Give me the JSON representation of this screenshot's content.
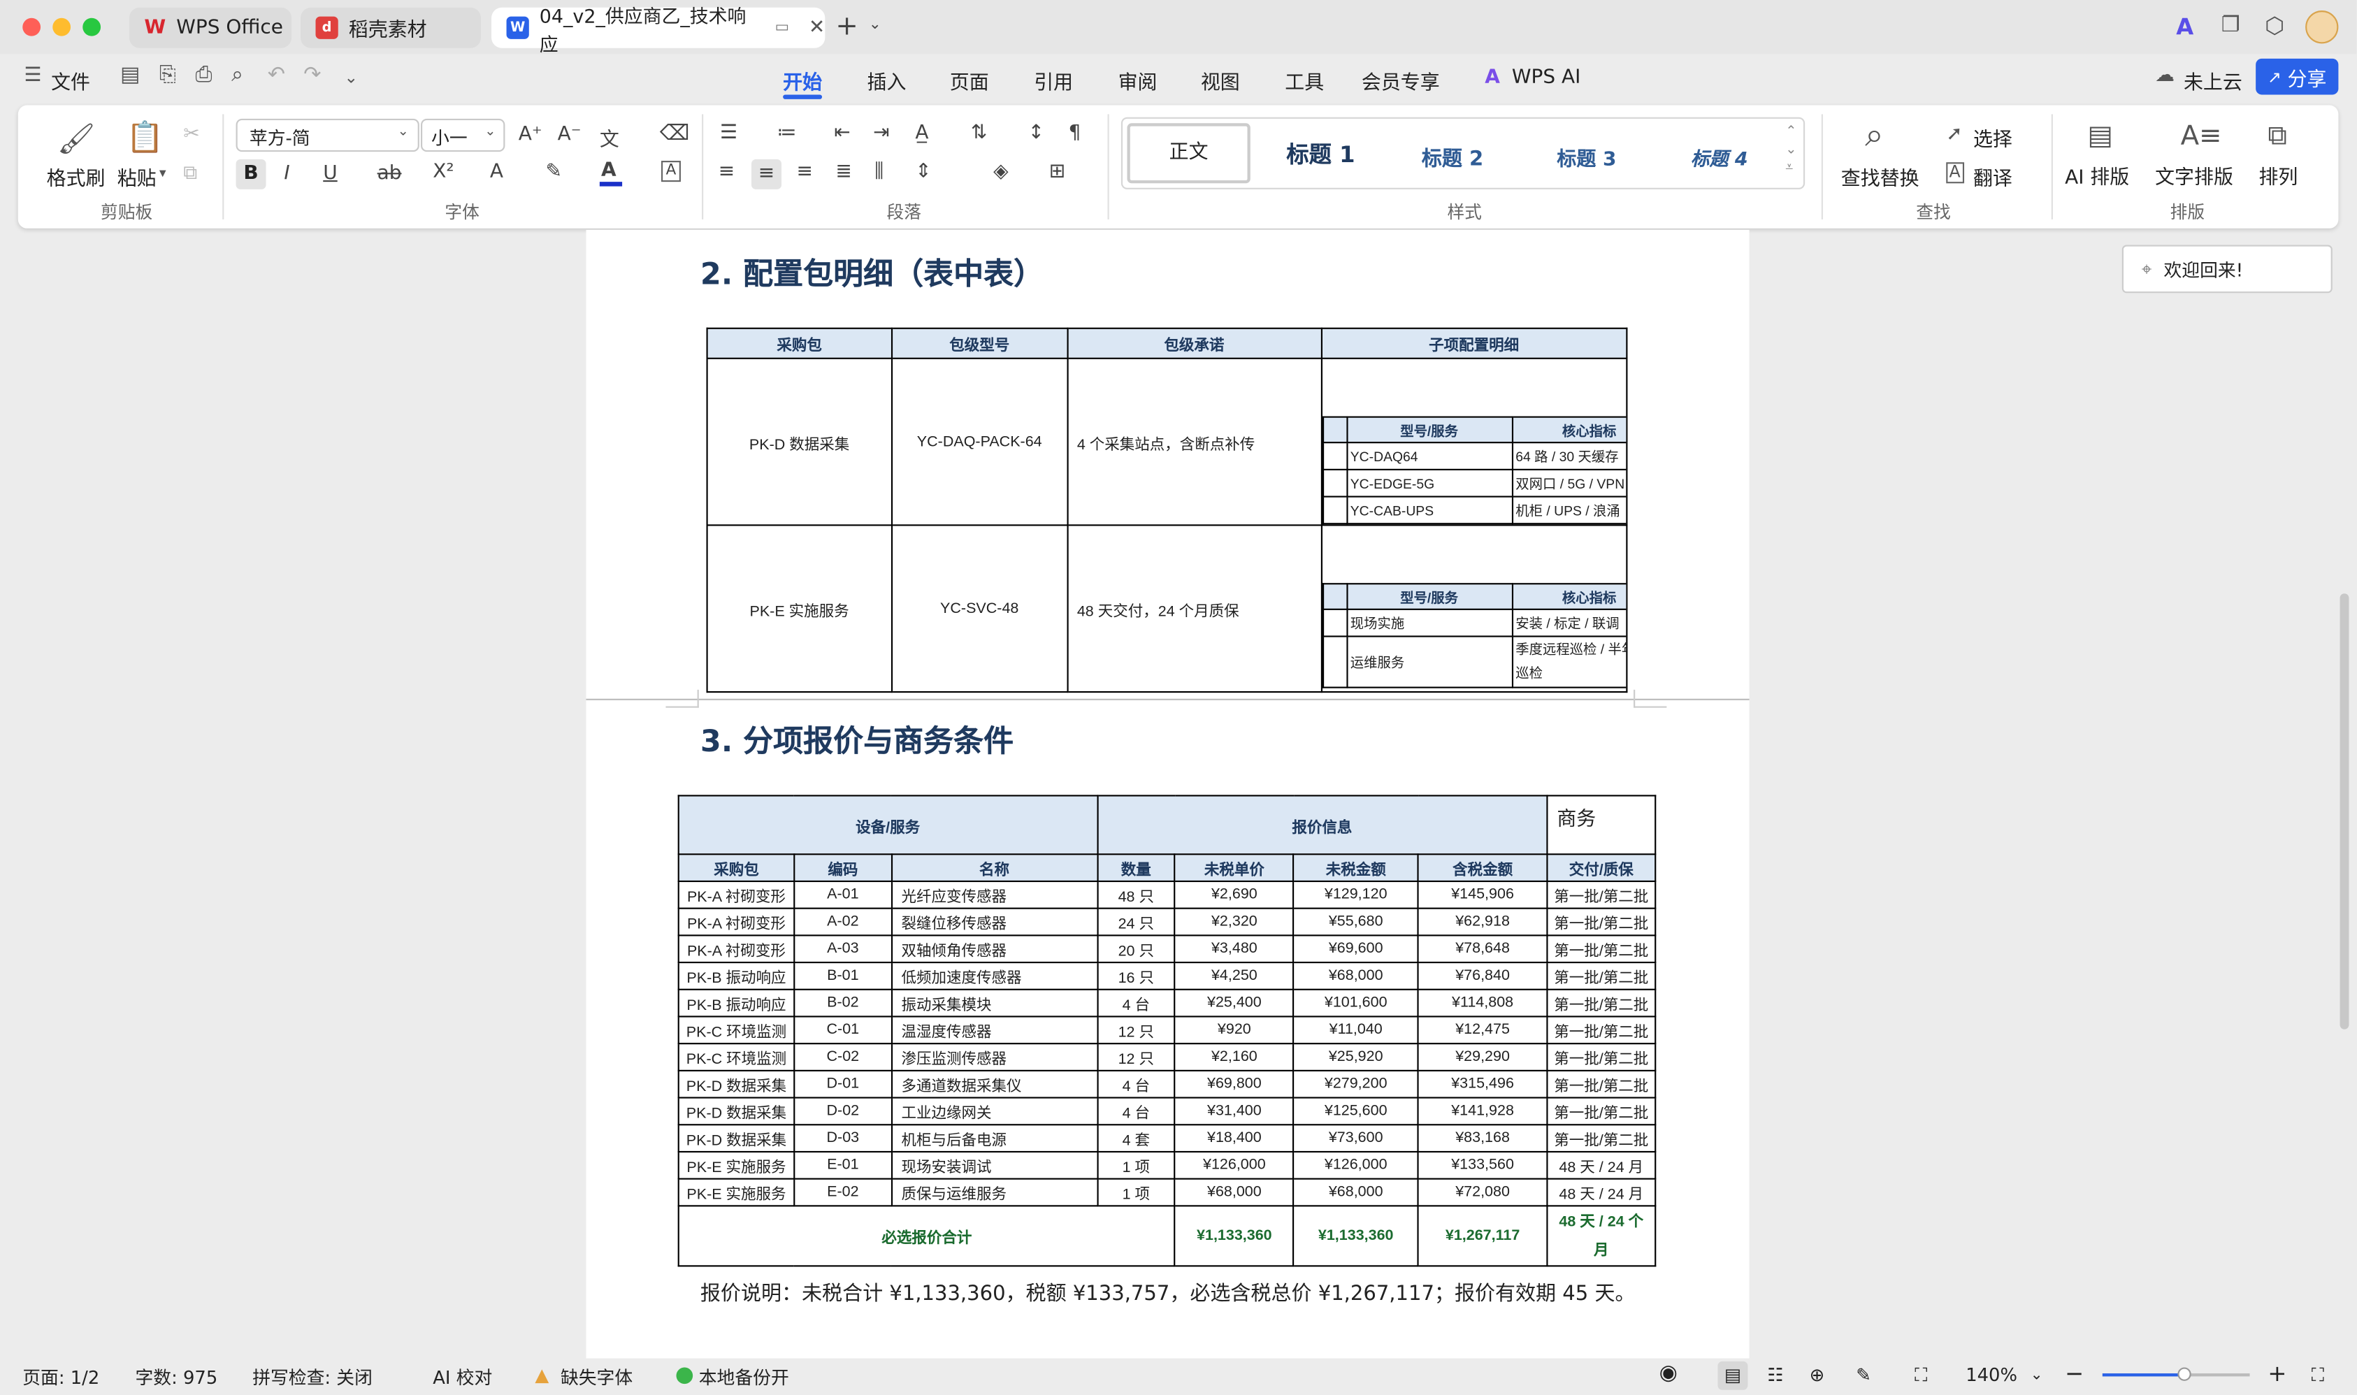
{
  "tabs": [
    {
      "label": "WPS Office"
    },
    {
      "label": "稻壳素材"
    },
    {
      "label": "04_v2_供应商乙_技术响应"
    }
  ],
  "menu": {
    "file": "文件",
    "items": [
      "开始",
      "插入",
      "页面",
      "引用",
      "审阅",
      "视图",
      "工具",
      "会员专享",
      "WPS AI"
    ],
    "cloud": "未上云",
    "share": "分享"
  },
  "ribbon": {
    "format_painter": "格式刷",
    "paste": "粘贴",
    "clipboard_group": "剪贴板",
    "font_name": "苹方-简",
    "font_size": "小一",
    "font_group": "字体",
    "para_group": "段落",
    "styles": [
      "正文",
      "标题 1",
      "标题 2",
      "标题 3",
      "标题 4"
    ],
    "styles_group": "样式",
    "find_replace": "查找替换",
    "select": "选择",
    "translate": "翻译",
    "find_group": "查找",
    "ai_layout": "AI 排版",
    "text_layout": "文字排版",
    "arrange": "排列",
    "layout_group": "排版"
  },
  "welcome": "欢迎回来!",
  "doc": {
    "section2": "2. 配置包明细（表中表）",
    "t2_headers": [
      "采购包",
      "包级型号",
      "包级承诺",
      "子项配置明细"
    ],
    "t2_rows": [
      {
        "pkg": "PK-D 数据采集",
        "model": "YC-DAQ-PACK-64",
        "promise": "4 个采集站点，含断点补传",
        "sub_headers": [
          "型号/服务",
          "核心指标"
        ],
        "sub": [
          [
            "YC-DAQ64",
            "64 路 / 30 天缓存"
          ],
          [
            "YC-EDGE-5G",
            "双网口 / 5G / VPN"
          ],
          [
            "YC-CAB-UPS",
            "机柜 / UPS / 浪涌"
          ]
        ]
      },
      {
        "pkg": "PK-E 实施服务",
        "model": "YC-SVC-48",
        "promise": "48 天交付，24 个月质保",
        "sub_headers": [
          "型号/服务",
          "核心指标"
        ],
        "sub": [
          [
            "现场实施",
            "安装 / 标定 / 联调"
          ],
          [
            "运维服务",
            "季度远程巡检 / 半年现场巡检"
          ]
        ]
      }
    ],
    "section3": "3. 分项报价与商务条件",
    "t3_group_headers": [
      "设备/服务",
      "报价信息",
      "商务"
    ],
    "t3_headers": [
      "采购包",
      "编码",
      "名称",
      "数量",
      "未税单价",
      "未税金额",
      "含税金额",
      "交付/质保"
    ],
    "t3_rows": [
      [
        "PK-A 衬砌变形",
        "A-01",
        "光纤应变传感器",
        "48 只",
        "¥2,690",
        "¥129,120",
        "¥145,906",
        "第一批/第二批"
      ],
      [
        "PK-A 衬砌变形",
        "A-02",
        "裂缝位移传感器",
        "24 只",
        "¥2,320",
        "¥55,680",
        "¥62,918",
        "第一批/第二批"
      ],
      [
        "PK-A 衬砌变形",
        "A-03",
        "双轴倾角传感器",
        "20 只",
        "¥3,480",
        "¥69,600",
        "¥78,648",
        "第一批/第二批"
      ],
      [
        "PK-B 振动响应",
        "B-01",
        "低频加速度传感器",
        "16 只",
        "¥4,250",
        "¥68,000",
        "¥76,840",
        "第一批/第二批"
      ],
      [
        "PK-B 振动响应",
        "B-02",
        "振动采集模块",
        "4 台",
        "¥25,400",
        "¥101,600",
        "¥114,808",
        "第一批/第二批"
      ],
      [
        "PK-C 环境监测",
        "C-01",
        "温湿度传感器",
        "12 只",
        "¥920",
        "¥11,040",
        "¥12,475",
        "第一批/第二批"
      ],
      [
        "PK-C 环境监测",
        "C-02",
        "渗压监测传感器",
        "12 只",
        "¥2,160",
        "¥25,920",
        "¥29,290",
        "第一批/第二批"
      ],
      [
        "PK-D 数据采集",
        "D-01",
        "多通道数据采集仪",
        "4 台",
        "¥69,800",
        "¥279,200",
        "¥315,496",
        "第一批/第二批"
      ],
      [
        "PK-D 数据采集",
        "D-02",
        "工业边缘网关",
        "4 台",
        "¥31,400",
        "¥125,600",
        "¥141,928",
        "第一批/第二批"
      ],
      [
        "PK-D 数据采集",
        "D-03",
        "机柜与后备电源",
        "4 套",
        "¥18,400",
        "¥73,600",
        "¥83,168",
        "第一批/第二批"
      ],
      [
        "PK-E 实施服务",
        "E-01",
        "现场安装调试",
        "1 项",
        "¥126,000",
        "¥126,000",
        "¥133,560",
        "48 天 / 24 月"
      ],
      [
        "PK-E 实施服务",
        "E-02",
        "质保与运维服务",
        "1 项",
        "¥68,000",
        "¥68,000",
        "¥72,080",
        "48 天 / 24 月"
      ]
    ],
    "total": {
      "label": "必选报价合计",
      "unit": "¥1,133,360",
      "net": "¥1,133,360",
      "gross": "¥1,267,117",
      "delivery": "48 天 / 24 个月"
    },
    "note": "报价说明：未税合计 ¥1,133,360，税额 ¥133,757，必选含税总价 ¥1,267,117；报价有效期 45 天。"
  },
  "status": {
    "page": "页面: 1/2",
    "words": "字数: 975",
    "spell": "拼写检查: 关闭",
    "ai_check": "AI 校对",
    "missing_font": "缺失字体",
    "backup": "本地备份开",
    "zoom": "140%",
    "zoom_level": 0.55
  }
}
